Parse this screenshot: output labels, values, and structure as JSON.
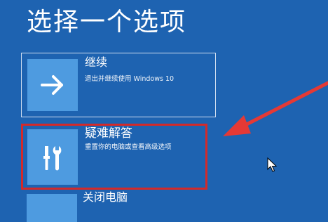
{
  "page": {
    "title": "选择一个选项"
  },
  "options": [
    {
      "title": "继续",
      "description": "退出并继续使用 Windows 10",
      "icon": "arrow-right-icon"
    },
    {
      "title": "疑难解答",
      "description": "重置你的电脑或查看高级选项",
      "icon": "tools-icon"
    },
    {
      "title": "关闭电脑",
      "description": "",
      "icon": "power-icon"
    }
  ],
  "colors": {
    "background": "#1e63b1",
    "tile": "#4e9be0",
    "highlight": "#d32a2a",
    "annotation_arrow": "#e53935"
  }
}
